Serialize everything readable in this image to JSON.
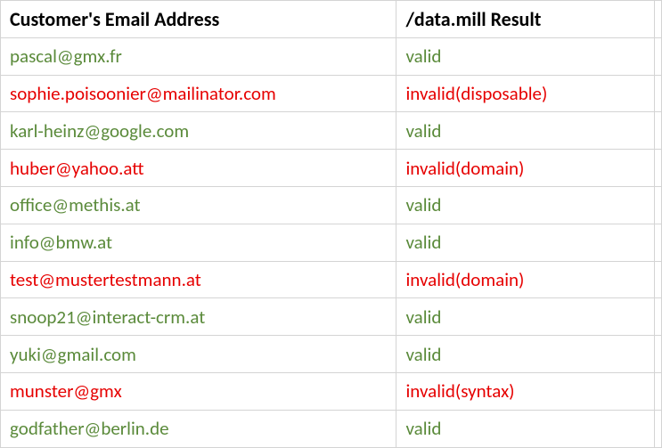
{
  "headers": {
    "email": "Customer's Email Address",
    "result": "/data.mill Result"
  },
  "rows": [
    {
      "email": "pascal@gmx.fr",
      "result": "valid",
      "status": "valid"
    },
    {
      "email": "sophie.poisoonier@mailinator.com",
      "result": "invalid(disposable)",
      "status": "invalid"
    },
    {
      "email": "karl-heinz@google.com",
      "result": "valid",
      "status": "valid"
    },
    {
      "email": "huber@yahoo.att",
      "result": "invalid(domain)",
      "status": "invalid"
    },
    {
      "email": "office@methis.at",
      "result": "valid",
      "status": "valid"
    },
    {
      "email": "info@bmw.at",
      "result": "valid",
      "status": "valid"
    },
    {
      "email": "test@mustertestmann.at",
      "result": "invalid(domain)",
      "status": "invalid"
    },
    {
      "email": "snoop21@interact-crm.at",
      "result": "valid",
      "status": "valid"
    },
    {
      "email": "yuki@gmail.com",
      "result": "valid",
      "status": "valid"
    },
    {
      "email": "munster@gmx",
      "result": "invalid(syntax)",
      "status": "invalid"
    },
    {
      "email": "godfather@berlin.de",
      "result": "valid",
      "status": "valid"
    }
  ]
}
